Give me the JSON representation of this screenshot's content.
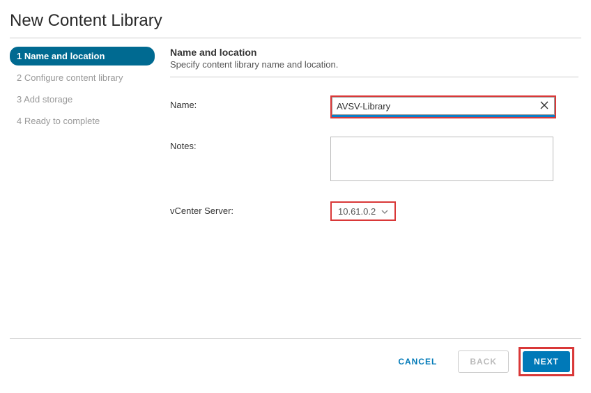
{
  "title": "New Content Library",
  "steps": [
    {
      "label": "1 Name and location",
      "active": true
    },
    {
      "label": "2 Configure content library",
      "active": false
    },
    {
      "label": "3 Add storage",
      "active": false
    },
    {
      "label": "4 Ready to complete",
      "active": false
    }
  ],
  "section": {
    "heading": "Name and location",
    "subheading": "Specify content library name and location."
  },
  "form": {
    "name_label": "Name:",
    "name_value": "AVSV-Library",
    "notes_label": "Notes:",
    "notes_value": "",
    "vcenter_label": "vCenter Server:",
    "vcenter_value": "10.61.0.2"
  },
  "buttons": {
    "cancel": "CANCEL",
    "back": "BACK",
    "next": "NEXT"
  }
}
